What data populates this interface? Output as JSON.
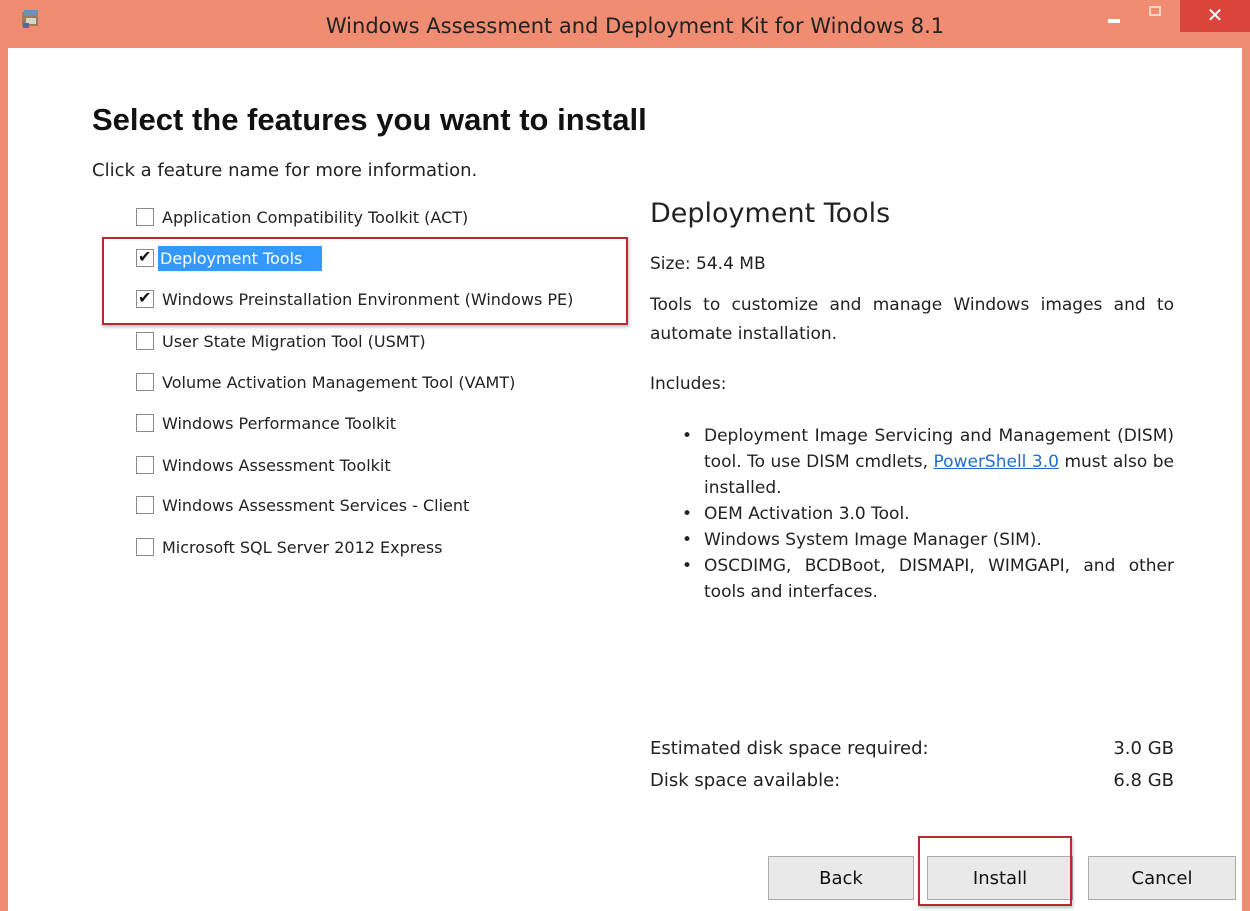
{
  "window": {
    "title": "Windows Assessment and Deployment Kit for Windows 8.1",
    "accent_color": "#f08c72",
    "close_color": "#d9443b"
  },
  "page": {
    "heading": "Select the features you want to install",
    "subheading": "Click a feature name for more information."
  },
  "features": [
    {
      "label": "Application Compatibility Toolkit (ACT)",
      "checked": false
    },
    {
      "label": "Deployment Tools",
      "checked": true,
      "selected": true
    },
    {
      "label": "Windows Preinstallation Environment (Windows PE)",
      "checked": true
    },
    {
      "label": "User State Migration Tool (USMT)",
      "checked": false
    },
    {
      "label": "Volume Activation Management Tool (VAMT)",
      "checked": false
    },
    {
      "label": "Windows Performance Toolkit",
      "checked": false
    },
    {
      "label": "Windows Assessment Toolkit",
      "checked": false
    },
    {
      "label": "Windows Assessment Services - Client",
      "checked": false
    },
    {
      "label": "Microsoft SQL Server 2012 Express",
      "checked": false
    }
  ],
  "details": {
    "title": "Deployment Tools",
    "size": "Size: 54.4 MB",
    "description": "Tools to customize and manage Windows images and to automate installation.",
    "includes_label": "Includes:",
    "includes": {
      "item1_before": "Deployment Image Servicing and Management (DISM) tool. To use DISM cmdlets, ",
      "item1_link": "PowerShell 3.0",
      "item1_after": " must also be installed.",
      "item2": "OEM Activation 3.0 Tool.",
      "item3": "Windows System Image Manager (SIM).",
      "item4": "OSCDIMG, BCDBoot, DISMAPI, WIMGAPI, and other tools and interfaces."
    }
  },
  "disk": {
    "required_label": "Estimated disk space required:",
    "required_value": "3.0 GB",
    "available_label": "Disk space available:",
    "available_value": "6.8 GB"
  },
  "buttons": {
    "back": "Back",
    "install": "Install",
    "cancel": "Cancel"
  }
}
